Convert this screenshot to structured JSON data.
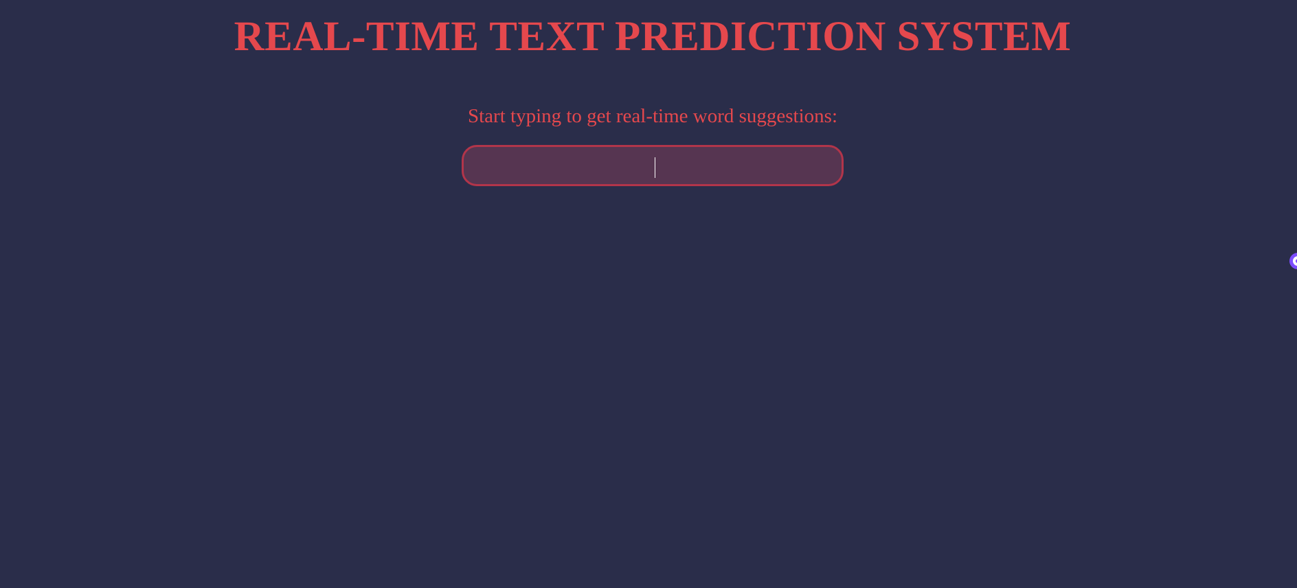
{
  "app": {
    "title": "REAL-TIME TEXT PREDICTION SYSTEM"
  },
  "main": {
    "prompt": "Start typing to get real-time word suggestions:",
    "input": {
      "value": "",
      "placeholder": ""
    }
  },
  "edge_widget": {
    "icon": "assistant-icon"
  },
  "colors": {
    "background": "#2a2d4a",
    "accent": "#e5484d",
    "input_background": "#563551",
    "input_border": "#b2354a",
    "widget": "#7c4dff"
  }
}
